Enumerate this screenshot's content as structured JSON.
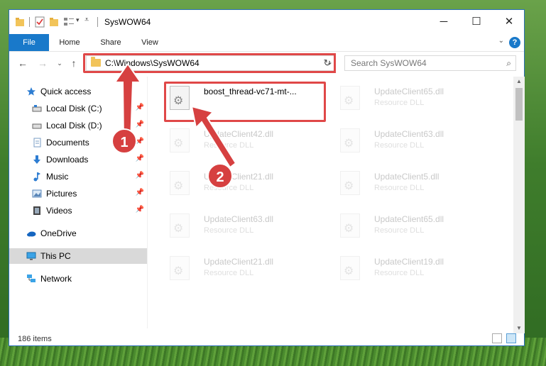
{
  "window": {
    "title": "SysWOW64",
    "controls": {
      "minimize": "─",
      "maximize": "☐",
      "close": "✕"
    }
  },
  "ribbon": {
    "tabs": [
      "File",
      "Home",
      "Share",
      "View"
    ],
    "help": "?"
  },
  "address": {
    "path": "C:\\Windows\\SysWOW64",
    "search_placeholder": "Search SysWOW64"
  },
  "nav": {
    "items": [
      {
        "label": "Quick access",
        "icon": "star-icon"
      },
      {
        "label": "Local Disk (C:)",
        "icon": "drive-icon",
        "pinned": true
      },
      {
        "label": "Local Disk (D:)",
        "icon": "drive-icon",
        "pinned": true
      },
      {
        "label": "Documents",
        "icon": "documents-icon",
        "pinned": true
      },
      {
        "label": "Downloads",
        "icon": "downloads-icon",
        "pinned": true
      },
      {
        "label": "Music",
        "icon": "music-icon",
        "pinned": true
      },
      {
        "label": "Pictures",
        "icon": "pictures-icon",
        "pinned": true
      },
      {
        "label": "Videos",
        "icon": "videos-icon",
        "pinned": true
      },
      {
        "label": "OneDrive",
        "icon": "cloud-icon"
      },
      {
        "label": "This PC",
        "icon": "computer-icon",
        "selected": true
      },
      {
        "label": "Network",
        "icon": "network-icon"
      }
    ]
  },
  "files": [
    {
      "name": "boost_thread-vc71-mt-...",
      "type": "",
      "highlighted": true
    },
    {
      "name": "UpdateClient65.dll",
      "type": "Resource DLL"
    },
    {
      "name": "UpdateClient42.dll",
      "type": "Resource DLL"
    },
    {
      "name": "UpdateClient63.dll",
      "type": "Resource DLL"
    },
    {
      "name": "UpdateClient21.dll",
      "type": "Resource DLL"
    },
    {
      "name": "UpdateClient5.dll",
      "type": "Resource DLL"
    },
    {
      "name": "UpdateClient63.dll",
      "type": "Resource DLL"
    },
    {
      "name": "UpdateClient65.dll",
      "type": "Resource DLL"
    },
    {
      "name": "UpdateClient21.dll",
      "type": "Resource DLL"
    },
    {
      "name": "UpdateClient19.dll",
      "type": "Resource DLL"
    }
  ],
  "status": {
    "item_count": "186 items"
  },
  "annotations": {
    "step1": "1",
    "step2": "2"
  },
  "colors": {
    "accent": "#1979ca",
    "highlight": "#e04848"
  }
}
